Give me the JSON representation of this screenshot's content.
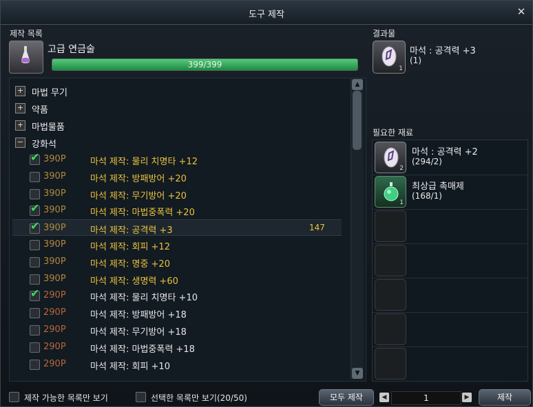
{
  "window": {
    "title": "도구 제작"
  },
  "left": {
    "section_label": "제작 목록",
    "recipe_name": "고급 연금술",
    "progress_text": "399/399",
    "progress": 1.0
  },
  "categories": [
    {
      "label": "마법 무기"
    },
    {
      "label": "약품"
    },
    {
      "label": "마법물품"
    },
    {
      "label": "강화석"
    }
  ],
  "rows": [
    {
      "checked": true,
      "points": "390P",
      "name": "마석 제작: 물리 치명타 +12",
      "count": ""
    },
    {
      "checked": false,
      "points": "390P",
      "name": "마석 제작: 방패방어 +20",
      "count": ""
    },
    {
      "checked": false,
      "points": "390P",
      "name": "마석 제작: 무기방어 +20",
      "count": ""
    },
    {
      "checked": true,
      "points": "390P",
      "name": "마석 제작: 마법중폭력 +20",
      "count": ""
    },
    {
      "checked": true,
      "points": "390P",
      "name": "마석 제작: 공격력 +3",
      "count": "147"
    },
    {
      "checked": false,
      "points": "390P",
      "name": "마석 제작: 회피 +12",
      "count": ""
    },
    {
      "checked": false,
      "points": "390P",
      "name": "마석 제작: 명중 +20",
      "count": ""
    },
    {
      "checked": false,
      "points": "390P",
      "name": "마석 제작: 생명력 +60",
      "count": ""
    },
    {
      "checked": true,
      "points": "290P",
      "name": "마석 제작: 물리 치명타 +10",
      "count": ""
    },
    {
      "checked": false,
      "points": "290P",
      "name": "마석 제작: 방패방어 +18",
      "count": ""
    },
    {
      "checked": false,
      "points": "290P",
      "name": "마석 제작: 무기방어 +18",
      "count": ""
    },
    {
      "checked": false,
      "points": "290P",
      "name": "마석 제작: 마법중폭력 +18",
      "count": ""
    },
    {
      "checked": false,
      "points": "290P",
      "name": "마석 제작: 회피 +10",
      "count": ""
    }
  ],
  "result": {
    "label": "결과물",
    "name": "마석 : 공격력 +3",
    "quantity": "(1)",
    "slot_count": "1"
  },
  "materials": {
    "label": "필요한 재료",
    "items": [
      {
        "name": "마석 : 공격력 +2",
        "quantity": "(294/2)",
        "slot_count": "2"
      },
      {
        "name": "최상급 촉매제",
        "quantity": "(168/1)",
        "slot_count": "1"
      }
    ]
  },
  "footer": {
    "only_craftable": "제작 가능한 목록만 보기",
    "only_selected": "선택한 목록만 보기(20/50)",
    "craft_all": "모두 제작",
    "amount": "1",
    "craft": "제작"
  },
  "colors": {
    "accent_gold": "#e9c33c",
    "check_green": "#3ddb5e",
    "bar_green": "#2fa557"
  }
}
